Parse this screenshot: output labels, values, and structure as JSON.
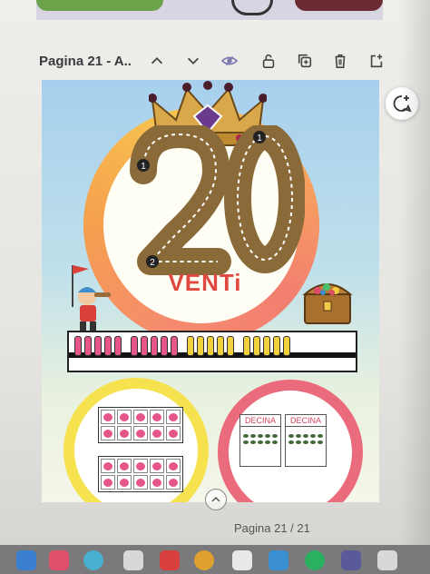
{
  "toolbar": {
    "page_title": "Pagina 21 - A.."
  },
  "page": {
    "number": "20",
    "word": "VENTi",
    "trace_labels": [
      "1",
      "1",
      "2"
    ],
    "decina_labels": [
      "DECINA",
      "DECINA"
    ]
  },
  "footer": {
    "page_counter": "Pagina 21 / 21"
  },
  "colors": {
    "ring": "#f5a04e",
    "number": "#8b6a3a",
    "venti": "#e0473e",
    "pink": "#e6568a",
    "yellow": "#f2d23c"
  },
  "icons": [
    "chevron-up-icon",
    "chevron-down-icon",
    "eye-icon",
    "lock-icon",
    "duplicate-icon",
    "trash-icon",
    "add-page-icon",
    "add-comment-icon"
  ]
}
